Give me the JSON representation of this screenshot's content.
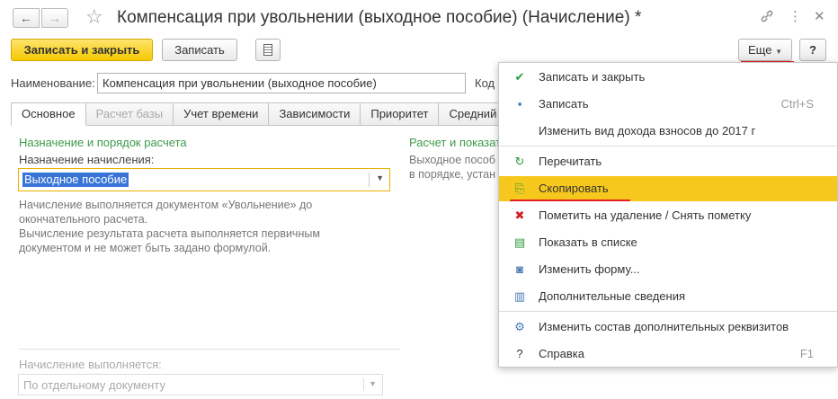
{
  "window": {
    "title": "Компенсация при увольнении (выходное пособие) (Начисление) *"
  },
  "toolbar": {
    "save_close_label": "Записать и закрыть",
    "save_label": "Записать",
    "more_label": "Еще",
    "help_label": "?"
  },
  "form": {
    "name_label": "Наименование:",
    "name_value": "Компенсация при увольнении (выходное пособие)",
    "code_label": "Код"
  },
  "tabs": [
    {
      "label": "Основное",
      "state": "active"
    },
    {
      "label": "Расчет базы",
      "state": "disabled"
    },
    {
      "label": "Учет времени",
      "state": "normal"
    },
    {
      "label": "Зависимости",
      "state": "normal"
    },
    {
      "label": "Приоритет",
      "state": "normal"
    },
    {
      "label": "Средний зар",
      "state": "normal"
    }
  ],
  "main": {
    "left_group_title": "Назначение и порядок расчета",
    "purpose_label": "Назначение начисления:",
    "purpose_value": "Выходное пособие",
    "hint_lines": [
      "Начисление выполняется документом «Увольнение» до",
      "окончательного расчета.",
      "Вычисление результата расчета выполняется первичным",
      "документом и не может быть задано формулой."
    ],
    "right_group_title": "Расчет и показат",
    "right_hint_lines": [
      "Выходное пособ",
      "в порядке, устан"
    ],
    "performed_label": "Начисление выполняется:",
    "performed_value": "По отдельному документу"
  },
  "menu": {
    "items": [
      {
        "label": "Записать и закрыть",
        "shortcut": "",
        "icon": "save-close-icon",
        "glyph": "✔",
        "color": "#2e9a3a"
      },
      {
        "label": "Записать",
        "shortcut": "Ctrl+S",
        "icon": "floppy-icon",
        "glyph": "▪",
        "color": "#3b6fb6"
      },
      {
        "label": "Изменить вид дохода взносов до 2017 г",
        "shortcut": "",
        "icon": "",
        "glyph": "",
        "color": ""
      },
      {
        "label": "Перечитать",
        "shortcut": "",
        "icon": "refresh-icon",
        "glyph": "↻",
        "color": "#2e9a3a"
      },
      {
        "label": "Скопировать",
        "shortcut": "",
        "icon": "copy-icon",
        "glyph": "⎘",
        "color": "#2e9a3a"
      },
      {
        "label": "Пометить на удаление / Снять пометку",
        "shortcut": "",
        "icon": "delete-mark-icon",
        "glyph": "✖",
        "color": "#d02020"
      },
      {
        "label": "Показать в списке",
        "shortcut": "",
        "icon": "list-icon",
        "glyph": "▤",
        "color": "#2e9a3a"
      },
      {
        "label": "Изменить форму...",
        "shortcut": "",
        "icon": "form-settings-icon",
        "glyph": "◙",
        "color": "#4a7ab5"
      },
      {
        "label": "Дополнительные сведения",
        "shortcut": "",
        "icon": "additional-info-icon",
        "glyph": "▥",
        "color": "#4a7ab5"
      },
      {
        "label": "Изменить состав дополнительных реквизитов",
        "shortcut": "",
        "icon": "attributes-settings-icon",
        "glyph": "⚙",
        "color": "#4a7ab5"
      },
      {
        "label": "Справка",
        "shortcut": "F1",
        "icon": "help-icon",
        "glyph": "?",
        "color": "#333333"
      }
    ]
  }
}
